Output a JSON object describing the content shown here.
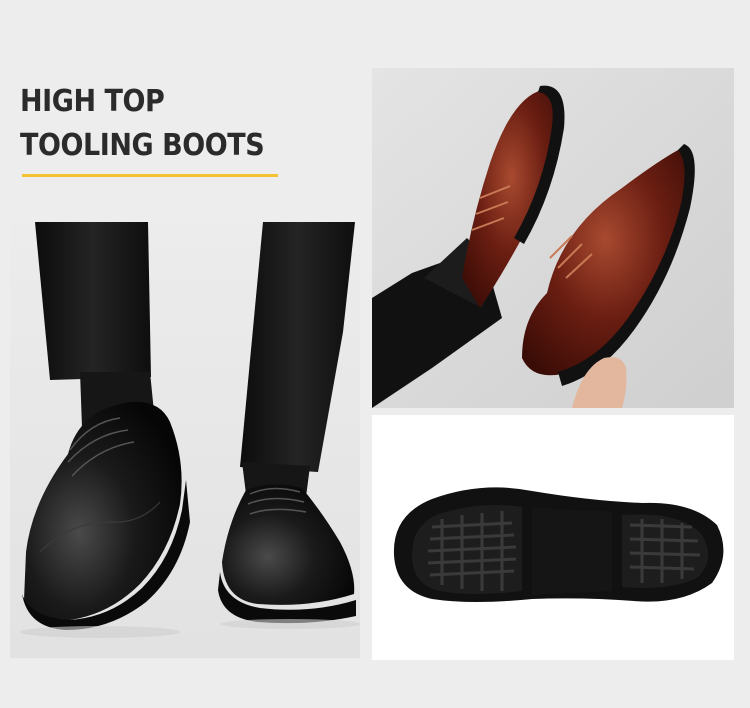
{
  "title": {
    "line1": "HIGH TOP",
    "line2": "TOOLING BOOTS"
  },
  "colors": {
    "accent_underline": "#f2c230",
    "background": "#ededed",
    "shoe_black": "#141414",
    "shoe_brown": "#6b1e12"
  },
  "images": [
    {
      "name": "black-shoes-on-feet-photo"
    },
    {
      "name": "brown-shoes-held-photo"
    },
    {
      "name": "sole-bottom-photo"
    }
  ]
}
